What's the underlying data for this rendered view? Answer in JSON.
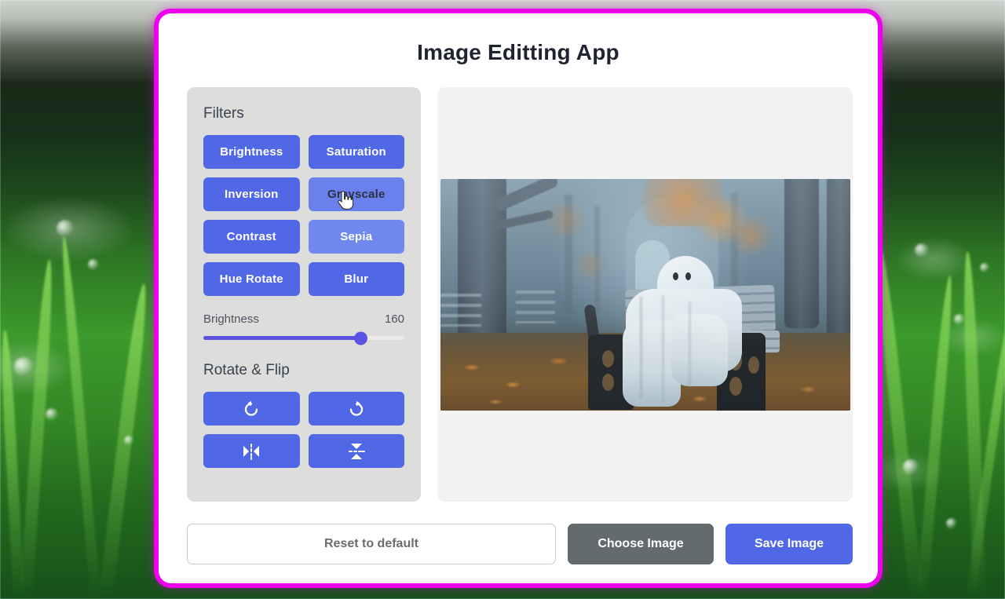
{
  "app": {
    "title": "Image Editting App"
  },
  "filters": {
    "heading": "Filters",
    "buttons": [
      {
        "label": "Brightness",
        "state": "normal"
      },
      {
        "label": "Saturation",
        "state": "normal"
      },
      {
        "label": "Inversion",
        "state": "normal"
      },
      {
        "label": "Grayscale",
        "state": "hovered"
      },
      {
        "label": "Contrast",
        "state": "normal"
      },
      {
        "label": "Sepia",
        "state": "active"
      },
      {
        "label": "Hue Rotate",
        "state": "normal"
      },
      {
        "label": "Blur",
        "state": "normal"
      }
    ]
  },
  "slider": {
    "label": "Brightness",
    "value": "160",
    "min": "0",
    "max": "200",
    "fill_percent": "78"
  },
  "rotate": {
    "heading": "Rotate & Flip",
    "buttons": [
      {
        "icon": "rotate-left-icon"
      },
      {
        "icon": "rotate-right-icon"
      },
      {
        "icon": "flip-horizontal-icon"
      },
      {
        "icon": "flip-vertical-icon"
      }
    ]
  },
  "preview": {
    "image_alt": "Ghost in a white sheet sitting on a park bench in a foggy autumn forest"
  },
  "actions": {
    "reset_label": "Reset to default",
    "choose_label": "Choose Image",
    "save_label": "Save Image"
  },
  "colors": {
    "accent_blue": "#5168e6",
    "accent_blue_active": "#7088ef",
    "card_border_magenta": "#ee00ee",
    "panel_gray": "#dddddb",
    "preview_gray": "#f2f2f2",
    "choose_gray": "#636b6e",
    "slider_blue": "#5a52e0"
  },
  "cursor": {
    "type": "pointer-hand-cursor"
  }
}
